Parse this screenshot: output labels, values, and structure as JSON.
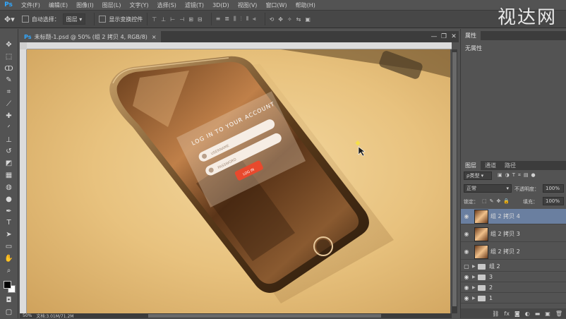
{
  "app": {
    "logo": "Ps",
    "watermark": "视达网"
  },
  "menu": [
    "文件(F)",
    "编辑(E)",
    "图像(I)",
    "图层(L)",
    "文字(Y)",
    "选择(S)",
    "滤镜(T)",
    "3D(D)",
    "视图(V)",
    "窗口(W)",
    "帮助(H)"
  ],
  "options": {
    "auto_select": "自动选择：",
    "auto_select_target": "图层",
    "show_transform": "显示变换控件"
  },
  "document": {
    "tab_title": "未标题-1.psd @ 50% (组 2 拷贝 4, RGB/8)",
    "close": "×"
  },
  "window_controls": {
    "minimize": "—",
    "restore": "❐",
    "close": "✕"
  },
  "status": {
    "zoom": "50%",
    "doc_info": "文档:3.01M/71.2M"
  },
  "properties_panel": {
    "tab": "属性",
    "content": "无属性"
  },
  "layers_panel": {
    "tabs": [
      "图层",
      "通道",
      "路径"
    ],
    "filter_kind": "ρ类型",
    "blend_mode": "正常",
    "opacity_label": "不透明度：",
    "opacity_value": "100%",
    "lock_label": "锁定：",
    "fill_label": "填充：",
    "fill_value": "100%",
    "layers": [
      {
        "name": "组 2 拷贝 4",
        "selected": true
      },
      {
        "name": "组 2 拷贝 3",
        "selected": false
      },
      {
        "name": "组 2 拷贝 2",
        "selected": false
      }
    ],
    "groups": [
      {
        "name": "组 2",
        "visible": false
      },
      {
        "name": "3",
        "visible": true
      },
      {
        "name": "2",
        "visible": true
      },
      {
        "name": "1",
        "visible": true
      }
    ]
  },
  "screen_ui": {
    "title": "LOG IN TO YOUR ACCOUNT",
    "username_placeholder": "USERNAME",
    "password_placeholder": "PASSWORD",
    "login_button": "LOG IN"
  },
  "icons": {
    "eye": "eye-icon",
    "folder": "folder-icon",
    "move": "move-tool-icon"
  },
  "colors": {
    "ui_bg": "#535353",
    "panel_dark": "#3c3c3c",
    "selected_layer": "#6a7fa0",
    "canvas_bg": "#e8c27e",
    "login_button": "#e8492d",
    "ps_blue": "#31a8ff"
  }
}
